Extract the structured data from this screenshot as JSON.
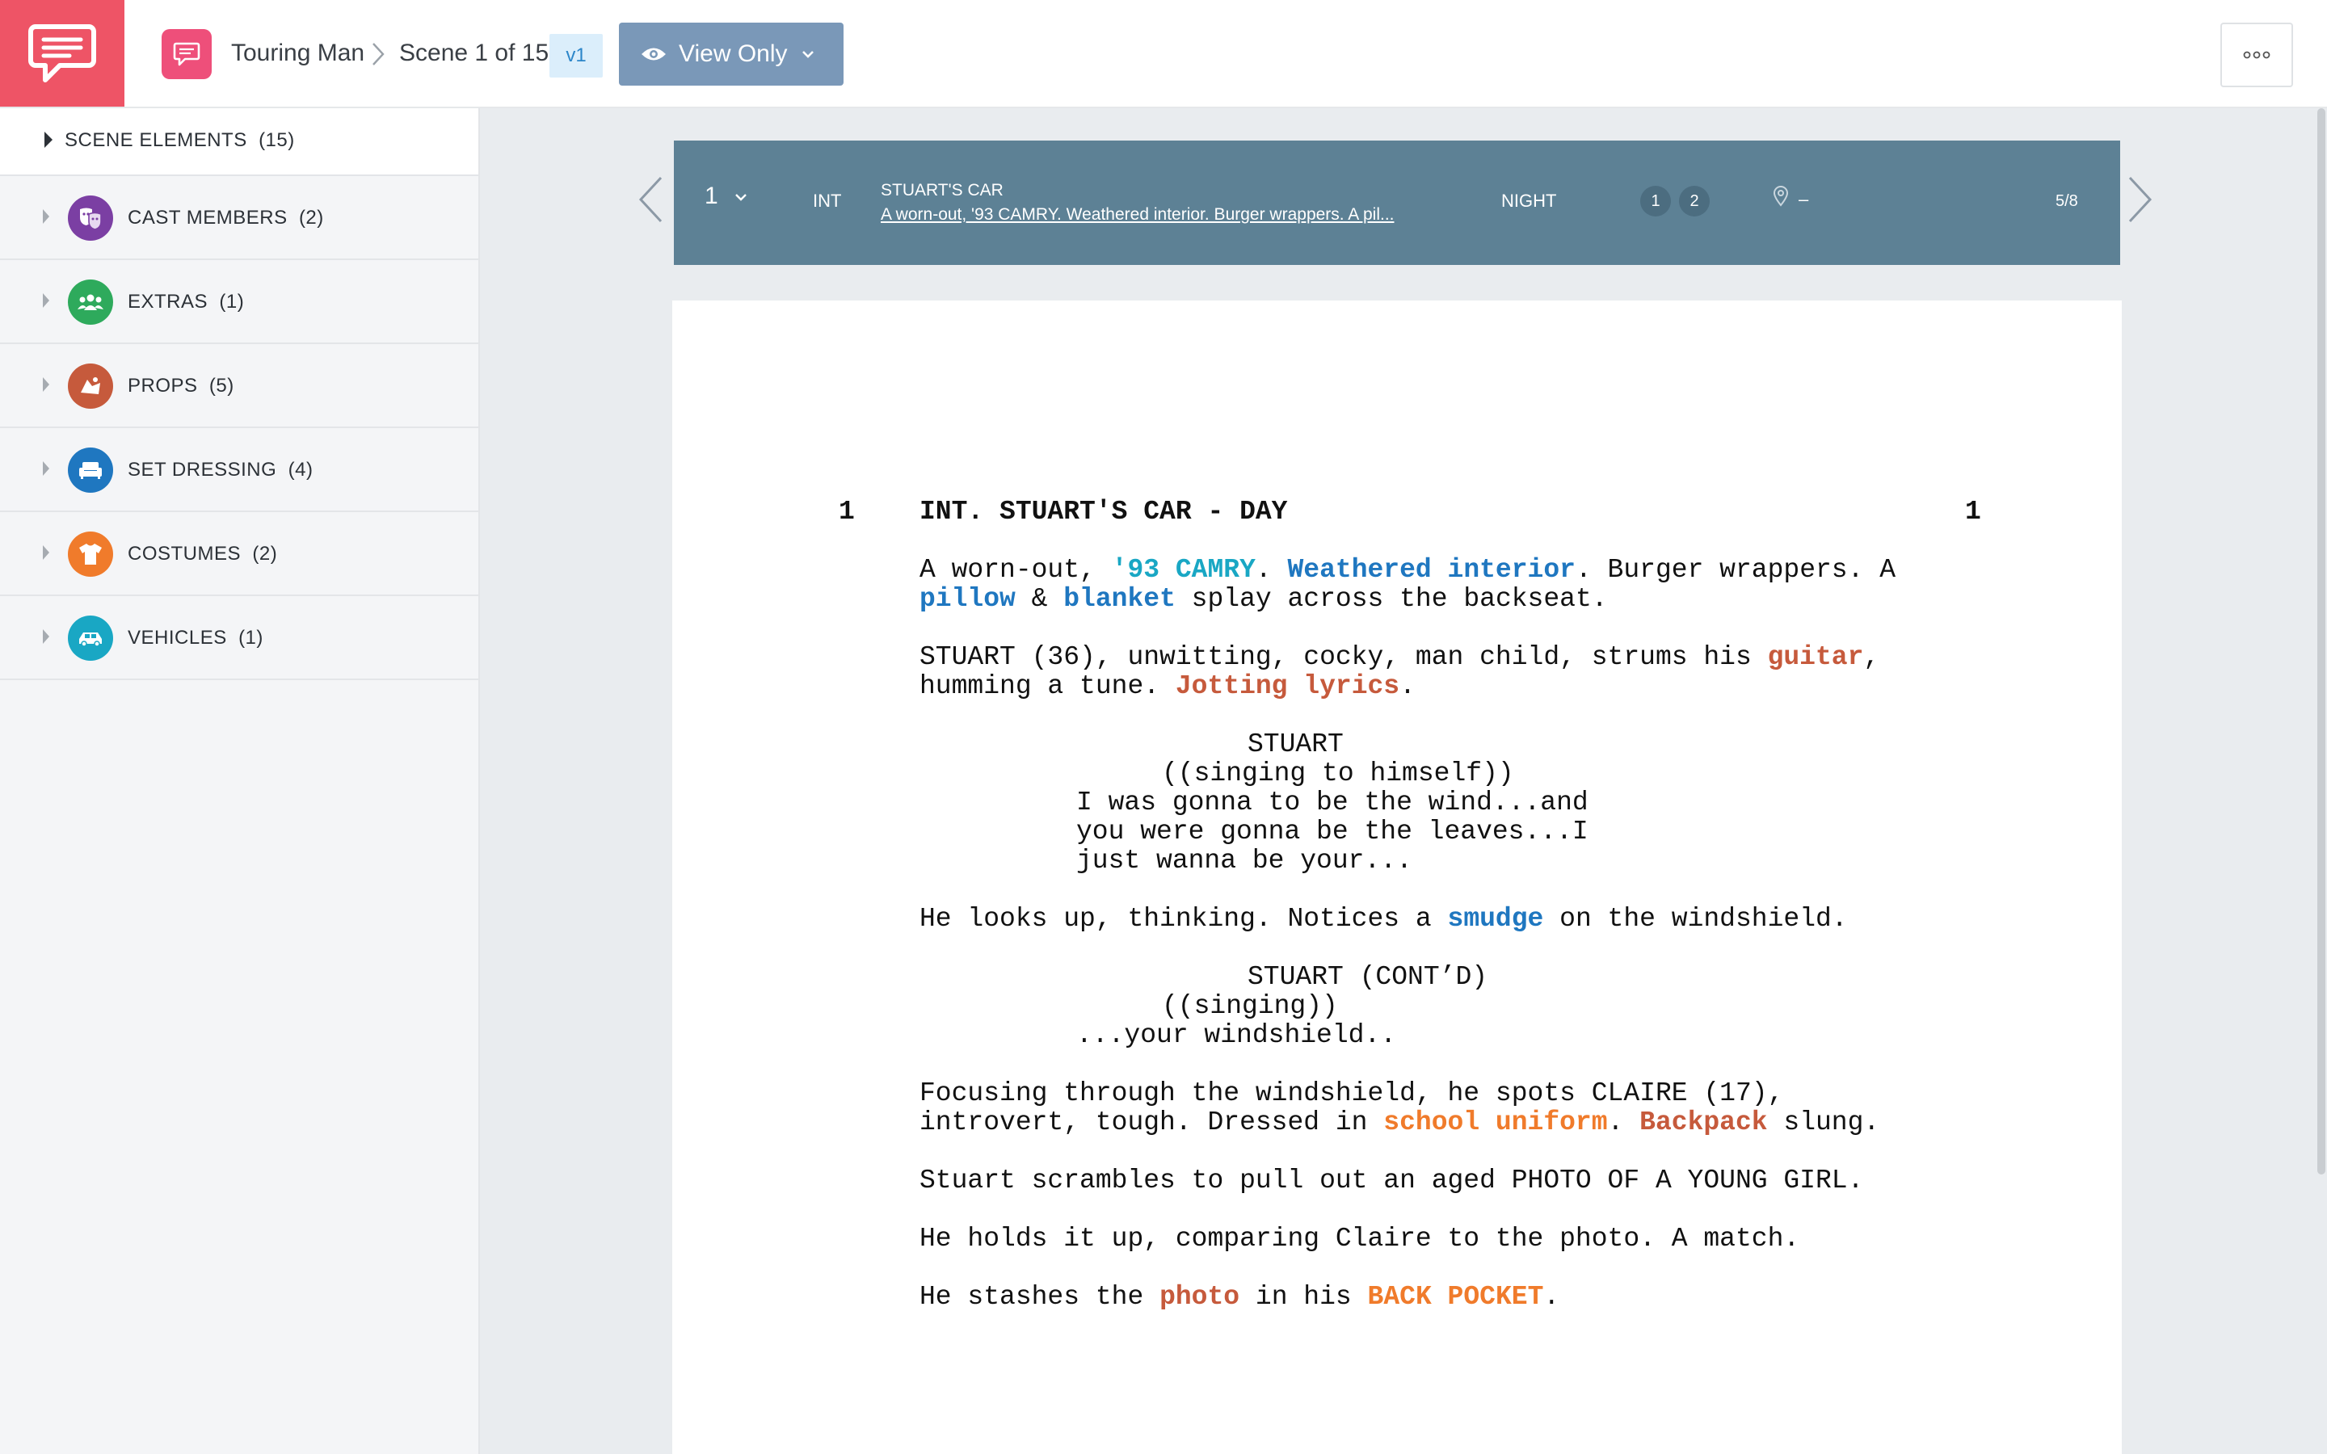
{
  "header": {
    "project": "Touring Man",
    "scene_label": "Scene 1 of 15",
    "version": "v1",
    "view_mode": "View Only"
  },
  "sidebar": {
    "scene_elements": {
      "label": "SCENE ELEMENTS",
      "count": "(15)"
    },
    "categories": [
      {
        "label": "CAST MEMBERS",
        "count": "(2)",
        "icon": "theater-masks-icon",
        "color": "#7b3fa3"
      },
      {
        "label": "EXTRAS",
        "count": "(1)",
        "icon": "people-group-icon",
        "color": "#2eaa5c"
      },
      {
        "label": "PROPS",
        "count": "(5)",
        "icon": "props-icon",
        "color": "#c65a3c"
      },
      {
        "label": "SET DRESSING",
        "count": "(4)",
        "icon": "sofa-icon",
        "color": "#1f77c0"
      },
      {
        "label": "COSTUMES",
        "count": "(2)",
        "icon": "shirt-icon",
        "color": "#f07b2b"
      },
      {
        "label": "VEHICLES",
        "count": "(1)",
        "icon": "car-icon",
        "color": "#19a7c4"
      }
    ]
  },
  "scene_strip": {
    "number": "1",
    "int_ext": "INT",
    "set_name": "STUART'S CAR",
    "description": "A worn-out, '93 CAMRY. Weathered interior. Burger wrappers. A pil...",
    "time_of_day": "NIGHT",
    "cast_ids": [
      "1",
      "2"
    ],
    "location": "–",
    "page_length": "5/8"
  },
  "script": {
    "scene_number": "1",
    "heading": "INT. STUART'S CAR - DAY",
    "a1": {
      "t1": "A worn-out, ",
      "h1": "'93 CAMRY",
      "t2": ". ",
      "h2": "Weathered interior",
      "t3": ". Burger wrappers. A"
    },
    "a1b": {
      "h1": "pillow",
      "t1": " & ",
      "h2": "blanket",
      "t2": " splay across the backseat."
    },
    "a2": {
      "t1": "STUART (36), unwitting, cocky, man child, strums his ",
      "h1": "guitar",
      "t2": ","
    },
    "a2b": {
      "t1": "humming a tune. ",
      "h1": "Jotting lyrics",
      "t2": "."
    },
    "c1": "STUART",
    "p1": "((singing to himself))",
    "d1": [
      "I was gonna to be the wind...and",
      "you were gonna be the leaves...I",
      "just wanna be your..."
    ],
    "a3": {
      "t1": "He looks up, thinking. Notices a ",
      "h1": "smudge",
      "t2": " on the windshield."
    },
    "c2": "STUART (CONT’D)",
    "p2": "((singing))",
    "d2": "...your windshield..",
    "a4": {
      "t1": "Focusing through the windshield, he spots CLAIRE (17),"
    },
    "a4b": {
      "t1": "introvert, tough. Dressed in ",
      "h1": "school uniform",
      "t2": ". ",
      "h2": "Backpack",
      "t3": " slung."
    },
    "a5": "Stuart scrambles to pull out an aged PHOTO OF A YOUNG GIRL.",
    "a6": "He holds it up, comparing Claire to the photo. A match.",
    "a7": {
      "t1": "He stashes the ",
      "h1": "photo",
      "t2": " in his ",
      "h2": "BACK POCKET",
      "t3": "."
    }
  }
}
